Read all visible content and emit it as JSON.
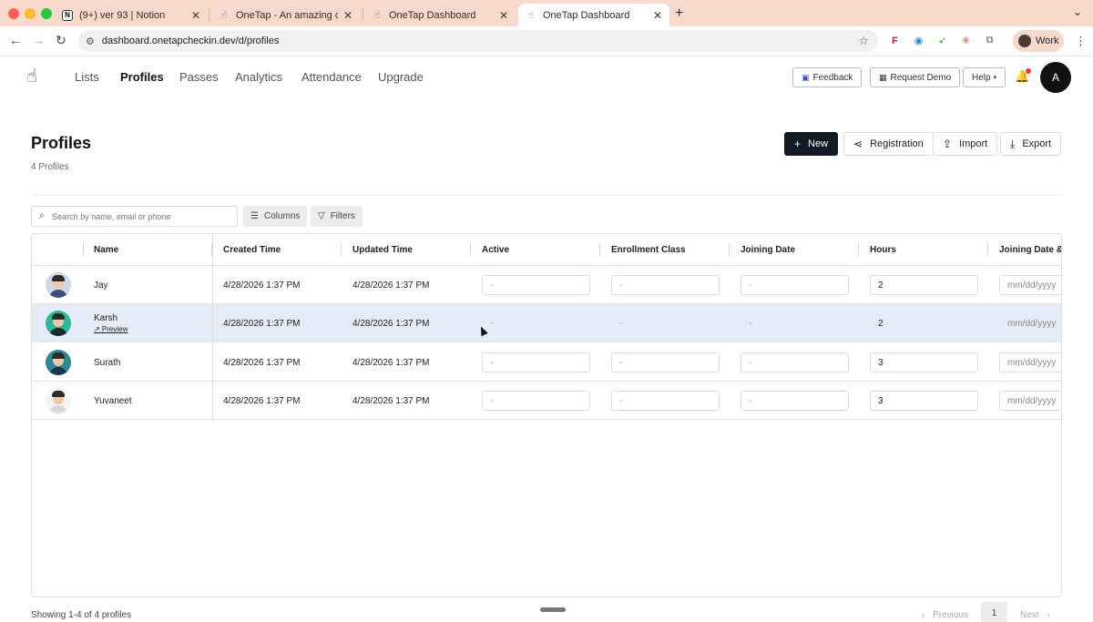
{
  "browser": {
    "tabs": [
      {
        "title": "(9+) ver 93 | Notion",
        "favicon": "notion-icon"
      },
      {
        "title": "OneTap - An amazing commu",
        "favicon": "onetap-icon"
      },
      {
        "title": "OneTap Dashboard",
        "favicon": "onetap-icon"
      },
      {
        "title": "OneTap Dashboard",
        "favicon": "onetap-icon",
        "active": true
      }
    ],
    "url": "dashboard.onetapcheckin.dev/d/profiles",
    "profile_label": "Work"
  },
  "nav": {
    "links": [
      "Lists",
      "Profiles",
      "Passes",
      "Analytics",
      "Attendance",
      "Upgrade"
    ],
    "active": "Profiles",
    "feedback_label": "Feedback",
    "request_demo_label": "Request Demo",
    "help_label": "Help",
    "avatar_initial": "A"
  },
  "page": {
    "title": "Profiles",
    "count_text": "4 Profiles",
    "new_label": "New",
    "registration_label": "Registration",
    "import_label": "Import",
    "export_label": "Export"
  },
  "toolbar": {
    "search_placeholder": "Search by name, email or phone",
    "columns_label": "Columns",
    "filters_label": "Filters"
  },
  "table": {
    "headers": [
      "Name",
      "Created Time",
      "Updated Time",
      "Active",
      "Enrollment Class",
      "Joining Date",
      "Hours",
      "Joining Date &"
    ],
    "rows": [
      {
        "name": "Jay",
        "created": "4/28/2026 1:37 PM",
        "updated": "4/28/2026 1:37 PM",
        "active": "-",
        "enrollment": "-",
        "joining": "-",
        "hours": "2",
        "joining_dt": "mm/dd/yyyy",
        "shirt": "#3f4a7a"
      },
      {
        "name": "Karsh",
        "preview": "↗ Preview",
        "created": "4/28/2026 1:37 PM",
        "updated": "4/28/2026 1:37 PM",
        "active": "-",
        "enrollment": "-",
        "joining": "-",
        "hours": "2",
        "joining_dt": "mm/dd/yyyy",
        "shirt": "#1d2b2a"
      },
      {
        "name": "Surath",
        "created": "4/28/2026 1:37 PM",
        "updated": "4/28/2026 1:37 PM",
        "active": "-",
        "enrollment": "-",
        "joining": "-",
        "hours": "3",
        "joining_dt": "mm/dd/yyyy",
        "shirt": "#16384a"
      },
      {
        "name": "Yuvaneet",
        "created": "4/28/2026 1:37 PM",
        "updated": "4/28/2026 1:37 PM",
        "active": "-",
        "enrollment": "-",
        "joining": "-",
        "hours": "3",
        "joining_dt": "mm/dd/yyyy",
        "shirt": "#d9d9d9"
      }
    ]
  },
  "footer": {
    "showing_text": "Showing 1-4 of 4 profiles",
    "previous_label": "Previous",
    "page": "1",
    "next_label": "Next"
  }
}
